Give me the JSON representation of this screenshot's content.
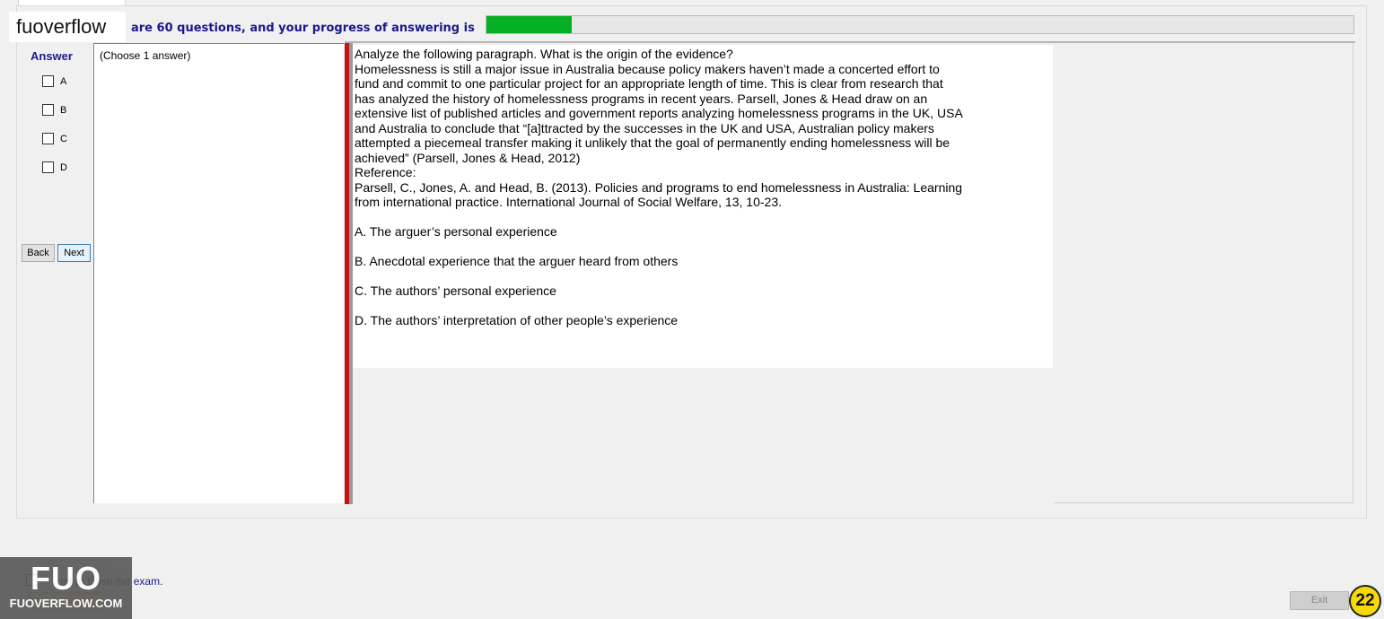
{
  "header": {
    "brand": "fuoverflow",
    "progress_text": "are 60 questions, and your progress of answering is",
    "progress": 0.098
  },
  "answer": {
    "title": "Answer",
    "options": [
      "A",
      "B",
      "C",
      "D"
    ],
    "choose_text": "(Choose 1 answer)"
  },
  "nav": {
    "back": "Back",
    "next": "Next"
  },
  "question": {
    "lines": [
      "Analyze the following paragraph. What is the origin of the evidence?",
      "Homelessness is still a major issue in Australia because policy makers haven’t made a concerted effort to",
      "fund and commit to one particular project for an appropriate length of time. This is clear from research that",
      "has analyzed the history of homelessness programs in recent years. Parsell, Jones & Head draw on an",
      "extensive list of published articles and government reports analyzing homelessness programs in the UK, USA",
      "and Australia to conclude that “[a]ttracted by the successes in the UK and USA, Australian policy makers",
      "attempted a piecemeal transfer making it unlikely that the goal of permanently ending homelessness will be",
      "achieved” (Parsell, Jones & Head, 2012)",
      "Reference:",
      "Parsell, C., Jones, A. and Head, B. (2013). Policies and programs to end homelessness in Australia: Learning",
      "from international practice. International Journal of Social Welfare, 13, 10-23."
    ],
    "options": [
      "A.  The arguer’s personal experience",
      "B.  Anecdotal experience that the arguer heard from others",
      "C.  The authors’ personal experience",
      "D.  The authors’ interpretation of other people’s experience"
    ]
  },
  "footer": {
    "finish_text": "ant to finish the exam.",
    "logo_big": "FUO",
    "logo_small": "FUOVERFLOW.COM",
    "exit_label": "Exit",
    "page_badge": "22"
  },
  "colors": {
    "progress_fill": "#06b025",
    "divider": "#c41414",
    "label_blue": "#1a1a8c",
    "badge": "#f5d90a"
  }
}
